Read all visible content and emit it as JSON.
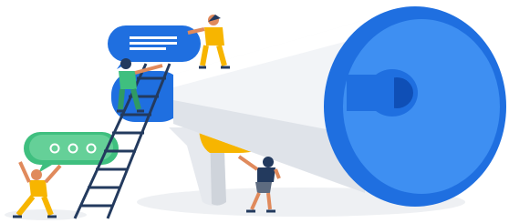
{
  "illustration": {
    "subject": "megaphone-announcement",
    "icons": [
      "megaphone-icon",
      "chat-bubble-lines-icon",
      "chat-bubble-dots-icon",
      "ladder-icon"
    ],
    "colors": {
      "megaphone_blue": "#1f6fe0",
      "megaphone_blue_light": "#3e8ff2",
      "megaphone_blue_dark": "#0f4fb6",
      "horn_white": "#f2f4f7",
      "horn_shadow": "#d9dde3",
      "yellow": "#f7b500",
      "green": "#3fbf7f",
      "green_light": "#7fdca8",
      "navy": "#233a5e",
      "skin": "#e08a5c",
      "ground": "#eef0f3"
    }
  }
}
